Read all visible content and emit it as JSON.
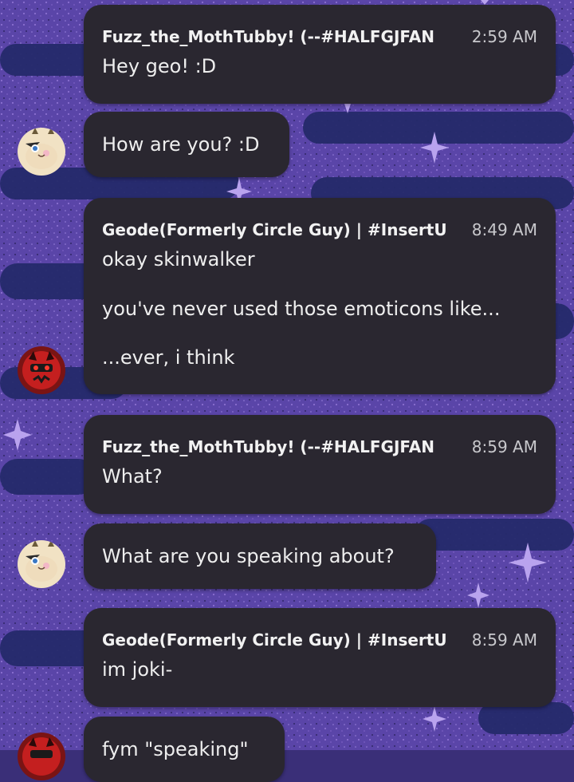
{
  "colors": {
    "bubble": "#2a2730",
    "background": "#3a2f78",
    "text": "#eeeeee"
  },
  "messages": [
    {
      "type": "group",
      "author": "Fuzz_the_MothTubby! (--#HALFGJFAN",
      "time": "2:59 AM",
      "lines": [
        "Hey geo! :D"
      ]
    },
    {
      "type": "continuation",
      "avatar": "moth-avatar",
      "lines": [
        "How are you? :D"
      ]
    },
    {
      "type": "group",
      "author": "Geode(Formerly Circle Guy) | #InsertU",
      "time": "8:49 AM",
      "lines": [
        "okay skinwalker",
        "you've never used those emoticons like...",
        "...ever, i think"
      ],
      "avatar": "geode-avatar"
    },
    {
      "type": "group",
      "author": "Fuzz_the_MothTubby! (--#HALFGJFAN",
      "time": "8:59 AM",
      "lines": [
        "What?"
      ]
    },
    {
      "type": "continuation",
      "avatar": "moth-avatar",
      "lines": [
        "What are you speaking about?"
      ]
    },
    {
      "type": "group",
      "author": "Geode(Formerly Circle Guy) | #InsertU",
      "time": "8:59 AM",
      "lines": [
        "im joki-"
      ]
    },
    {
      "type": "continuation",
      "avatar": "geode-avatar",
      "lines": [
        "fym \"speaking\""
      ]
    }
  ]
}
